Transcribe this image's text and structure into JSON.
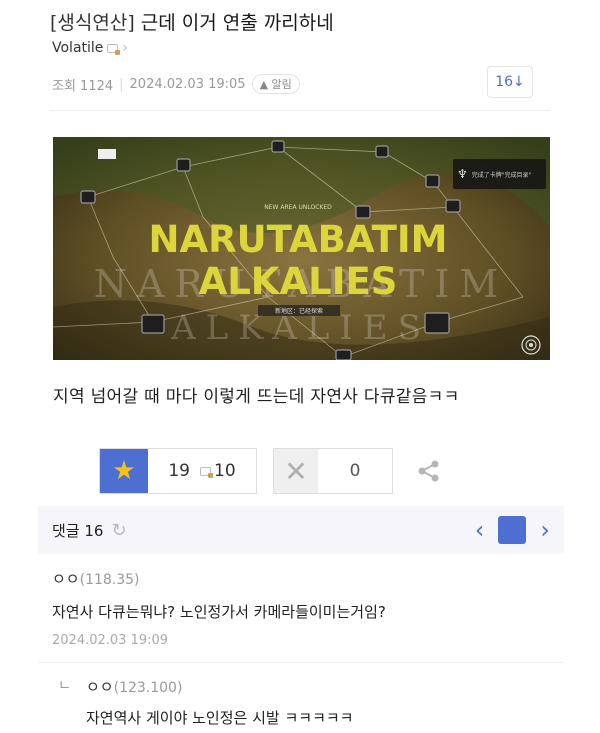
{
  "post": {
    "tag": "[생식연산]",
    "title": "근데 이거 연출 까리하네",
    "author": "Volatile",
    "views": "조회 1124",
    "date": "2024.02.03 19:05",
    "alarm": "알림",
    "comment_count_box": "16↓",
    "body": "지역 넘어갈 때 마다 이렇게 뜨는데 자연사 다큐같음ㅋㅋ"
  },
  "banner": {
    "small_label": "NEW AREA UNLOCKED",
    "headline_1": "NARUTABATIM",
    "headline_2": "ALKALIES",
    "bg_text_1": "NARUTABATIM",
    "bg_text_2": "ALKALIES",
    "sub_label": "新地区：已经探索",
    "achievement_text": "完成了卡牌\"完成目录\"",
    "colors": {
      "accent": "#d9d23a",
      "ground": "#6b5a2a"
    }
  },
  "actions": {
    "likes": "19",
    "bookmarks": "10",
    "dislikes": "0"
  },
  "comments": {
    "label": "댓글 16",
    "items": [
      {
        "name": "ㅇㅇ",
        "ip": "(118.35)",
        "text": "자연사 다큐는뭐냐? 노인정가서 카메라들이미는거임?",
        "date": "2024.02.03 19:09"
      },
      {
        "reply_mark": "ㄴ",
        "name": "ㅇㅇ",
        "ip": "(123.100)",
        "text": "자연역사 게이야 노인정은 시발 ㅋㅋㅋㅋㅋ"
      }
    ]
  },
  "icons": [
    "star-icon",
    "bookmark-icon",
    "x-icon",
    "share-icon",
    "refresh-icon",
    "chevron-left-icon",
    "chevron-right-icon",
    "trophy-icon",
    "notebook-icon"
  ]
}
